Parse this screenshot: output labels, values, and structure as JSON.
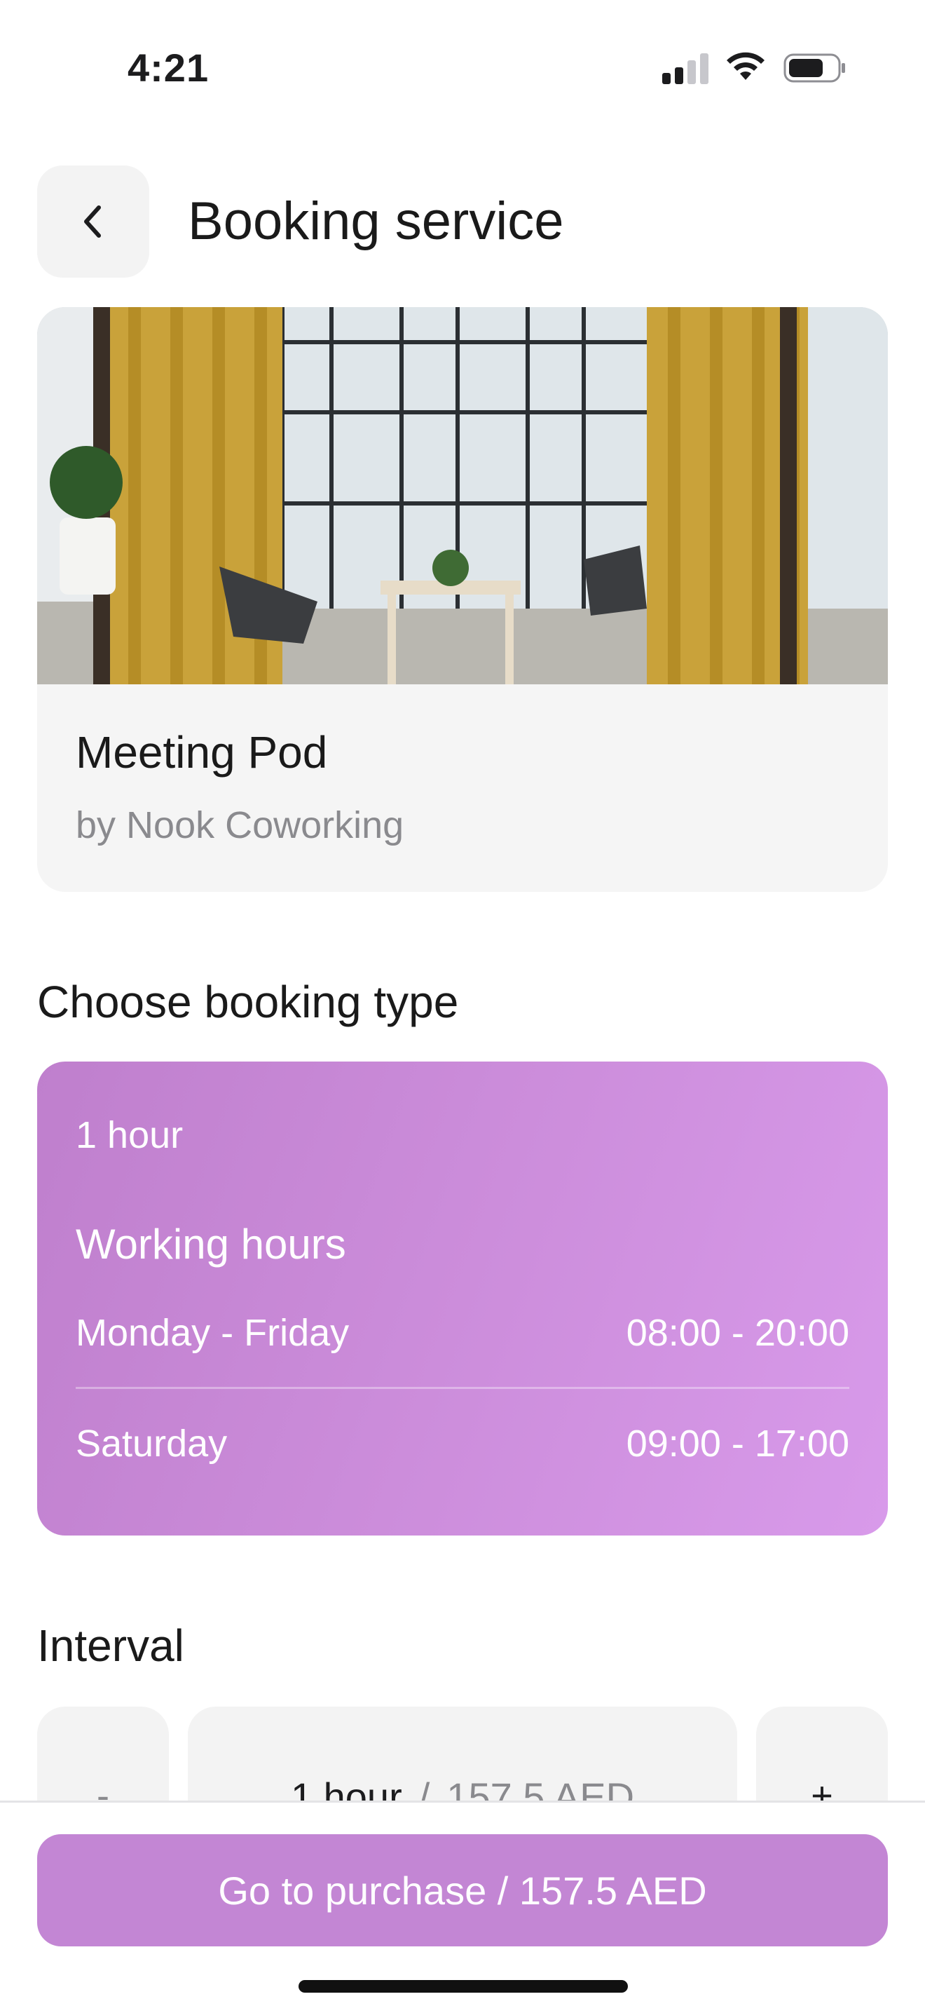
{
  "status_bar": {
    "time": "4:21"
  },
  "header": {
    "title": "Booking service"
  },
  "service": {
    "name": "Meeting Pod",
    "provider": "by Nook Coworking"
  },
  "booking_type": {
    "section_title": "Choose booking type",
    "duration": "1 hour",
    "hours_title": "Working hours",
    "schedule": [
      {
        "days": "Monday - Friday",
        "time": "08:00 - 20:00"
      },
      {
        "days": "Saturday",
        "time": "09:00 - 17:00"
      }
    ]
  },
  "interval": {
    "section_title": "Interval",
    "decrement_label": "-",
    "increment_label": "+",
    "value": "1 hour",
    "separator": "/",
    "price": "157.5 AED"
  },
  "purchase": {
    "label": "Go to purchase / 157.5 AED"
  },
  "colors": {
    "accent": "#c386d4",
    "card_gradient_start": "#bf7fcd",
    "card_gradient_end": "#d89aea"
  }
}
